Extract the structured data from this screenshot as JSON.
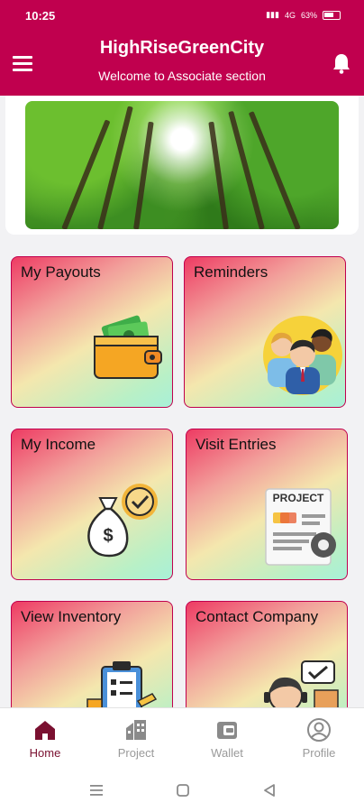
{
  "status": {
    "time": "10:25",
    "net": "4G",
    "battery": "63%"
  },
  "header": {
    "title": "HighRiseGreenCity",
    "subtitle": "Welcome to Associate section"
  },
  "tiles": [
    {
      "label": "My Payouts",
      "icon": "wallet-money-icon"
    },
    {
      "label": "Reminders",
      "icon": "team-people-icon"
    },
    {
      "label": "My Income",
      "icon": "money-bag-icon"
    },
    {
      "label": "Visit Entries",
      "icon": "project-document-icon"
    },
    {
      "label": "View Inventory",
      "icon": "clipboard-inventory-icon"
    },
    {
      "label": "Contact Company",
      "icon": "support-agent-icon"
    }
  ],
  "nav": [
    {
      "label": "Home",
      "icon": "home-icon",
      "active": true
    },
    {
      "label": "Project",
      "icon": "buildings-icon",
      "active": false
    },
    {
      "label": "Wallet",
      "icon": "wallet-icon",
      "active": false
    },
    {
      "label": "Profile",
      "icon": "profile-icon",
      "active": false
    }
  ],
  "colors": {
    "primary": "#c0004e",
    "nav_active": "#7a1030",
    "nav_inactive": "#9a9a9a"
  }
}
